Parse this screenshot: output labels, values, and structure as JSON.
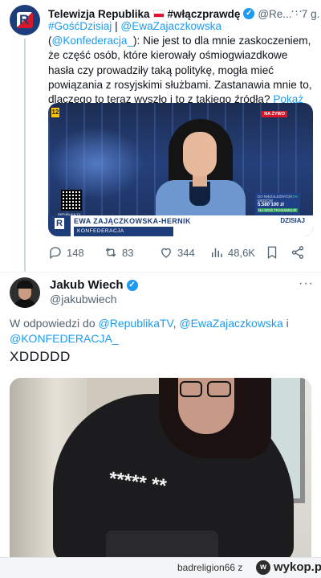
{
  "tweet1": {
    "account_name": "Telewizja Republika",
    "hashtag": "#włączprawdę",
    "handle_truncated": "@Re...",
    "time": "· 7 g.",
    "more": "···",
    "body": {
      "hashtag": "#GośćDzisiaj",
      "sep": " | ",
      "mention1": "@EwaZajaczkowska",
      "mention2_open": " (",
      "mention2": "@Konfederacja_",
      "mention2_close": "): Nie jest to dla mnie zaskoczeniem, że część osób, które kierowały ośmiogwiazdkowe hasła czy prowadziły taką politykę, mogła mieć powiązania z rosyjskimi służbami. Zastanawia mnie to, dlaczego to teraz wyszło i to z takiego źródła? ",
      "show_more": "Pokaż więcej"
    },
    "media": {
      "channel_badge": "12",
      "live_label": "NA ŻYWO",
      "lower_third_name": "EWA ZAJĄCZKOWSKA-HERNIK",
      "lower_third_party": "KONFEDERACJA",
      "program": "DZISIAJ",
      "qr_caption": "REPUBLIKA TV",
      "logo_letter": "R",
      "ticker_label": "DO NIEZALEŻNYCH MEDIÓW",
      "ticker_value": "5.580'100 zł",
      "ticker_tail": "NA WOŚ TRANSMISJE",
      "ticker_pct": "72%"
    },
    "actions": {
      "replies": "148",
      "reposts": "83",
      "likes": "344",
      "views": "48,6K"
    }
  },
  "tweet2": {
    "name": "Jakub Wiech",
    "handle": "@jakubwiech",
    "more": "···",
    "reply_prefix": "W odpowiedzi do ",
    "reply_mention1": "@RepublikaTV",
    "reply_sep1": ", ",
    "reply_mention2": "@EwaZajaczkowska",
    "reply_sep2": " i ",
    "reply_mention3": "@KONFEDERACJA_",
    "text": "XDDDDD",
    "shirt_stars": "*****  **"
  },
  "footer": {
    "user": "badreligion66",
    "connector": "z",
    "brand": "wykop.pl"
  },
  "colors": {
    "link": "#1d9bf0",
    "muted": "#536471",
    "republika_navy": "#1d3d7a",
    "republika_red": "#d7182a"
  }
}
